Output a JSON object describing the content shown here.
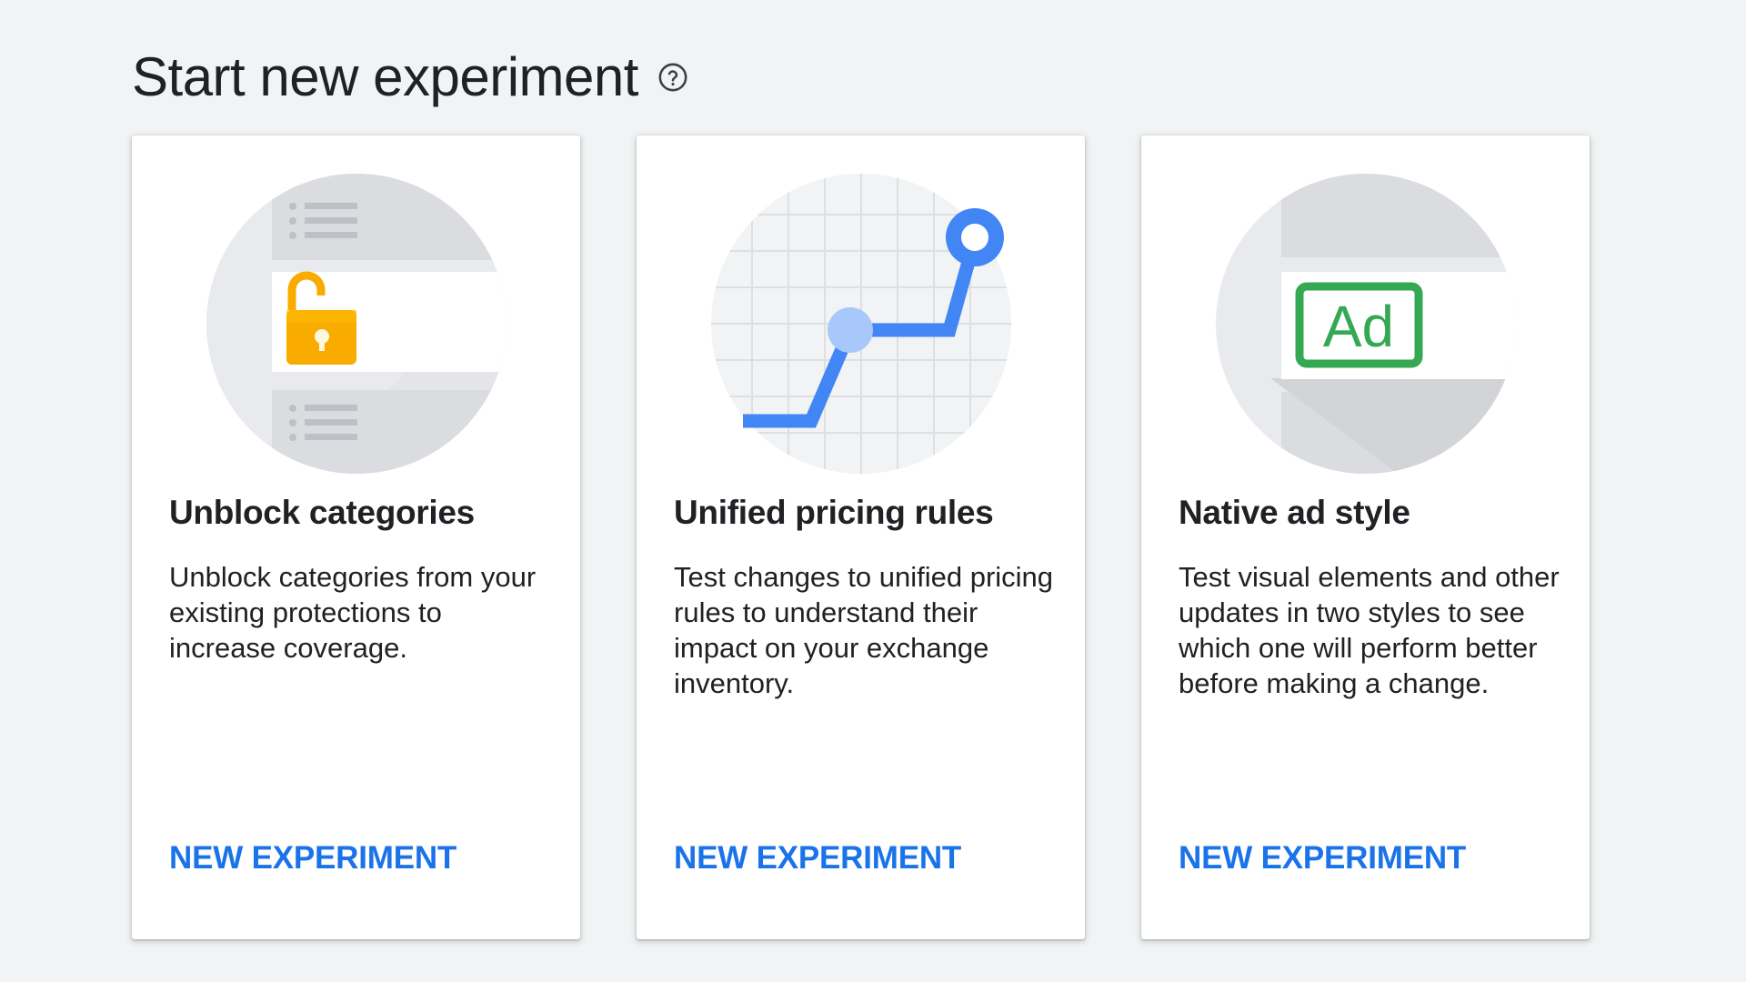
{
  "header": {
    "title": "Start new experiment",
    "help_icon": "help-circle-icon"
  },
  "colors": {
    "background": "#f1f3f4",
    "card": "#ffffff",
    "accent": "#1a73e8",
    "lock": "#f9ab00",
    "ad_badge": "#34a853",
    "chart_line": "#4285f4"
  },
  "cards": [
    {
      "title": "Unblock categories",
      "description": "Unblock categories from your existing protections to increase coverage.",
      "action": "NEW EXPERIMENT",
      "icon": "unlocked-padlock-icon"
    },
    {
      "title": "Unified pricing rules",
      "description": "Test changes to unified pricing rules to understand their impact on your exchange inventory.",
      "action": "NEW EXPERIMENT",
      "icon": "pricing-trend-line-icon"
    },
    {
      "title": "Native ad style",
      "description": "Test visual elements and other updates in two styles to see which one will perform better before making a change.",
      "action": "NEW EXPERIMENT",
      "icon": "ad-badge-icon",
      "badge_text": "Ad"
    }
  ]
}
